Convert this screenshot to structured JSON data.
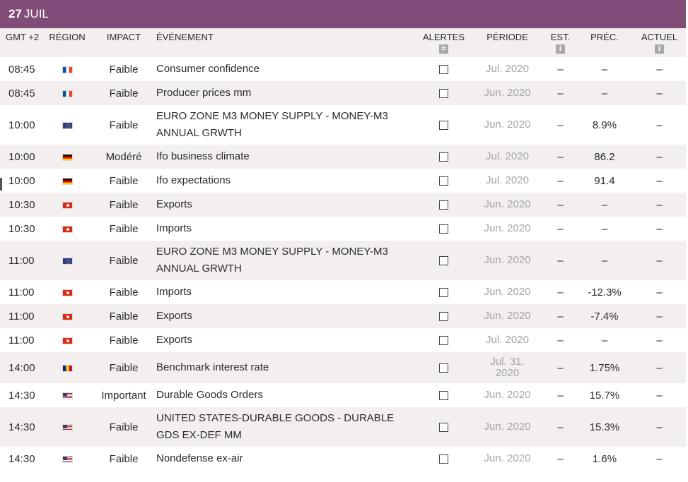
{
  "date": {
    "day": "27",
    "month": "JUIL"
  },
  "columns": {
    "time": "GMT +2",
    "region": "RÉGION",
    "impact": "IMPACT",
    "event": "ÉVÉNEMENT",
    "alerts": "ALERTES",
    "alerts_icon": "gear-icon",
    "period": "PÉRIODE",
    "est": "EST.",
    "est_icon": "info-icon",
    "prev": "PRÉC.",
    "actual": "ACTUEL",
    "actual_icon": "info-icon",
    "info_glyph": "i",
    "gear_glyph": "✲"
  },
  "rows": [
    {
      "time": "08:45",
      "flag": "fr",
      "impact": "Faible",
      "event": "Consumer confidence",
      "period": "Jul. 2020",
      "est": "–",
      "prev": "–",
      "actual": "–"
    },
    {
      "time": "08:45",
      "flag": "fr",
      "impact": "Faible",
      "event": "Producer prices mm",
      "period": "Jun. 2020",
      "est": "–",
      "prev": "–",
      "actual": "–"
    },
    {
      "time": "10:00",
      "flag": "eu",
      "impact": "Faible",
      "event": "EURO ZONE M3 MONEY SUPPLY - MONEY-M3 ANNUAL GRWTH",
      "period": "Jun. 2020",
      "est": "–",
      "prev": "8.9%",
      "actual": "–"
    },
    {
      "time": "10:00",
      "flag": "de",
      "impact": "Modéré",
      "event": "Ifo business climate",
      "period": "Jul. 2020",
      "est": "–",
      "prev": "86.2",
      "actual": "–"
    },
    {
      "time": "10:00",
      "flag": "de",
      "impact": "Faible",
      "event": "Ifo expectations",
      "period": "Jul. 2020",
      "est": "–",
      "prev": "91.4",
      "actual": "–"
    },
    {
      "time": "10:30",
      "flag": "hk",
      "impact": "Faible",
      "event": "Exports",
      "period": "Jun. 2020",
      "est": "–",
      "prev": "–",
      "actual": "–"
    },
    {
      "time": "10:30",
      "flag": "hk",
      "impact": "Faible",
      "event": "Imports",
      "period": "Jun. 2020",
      "est": "–",
      "prev": "–",
      "actual": "–"
    },
    {
      "time": "11:00",
      "flag": "eu",
      "impact": "Faible",
      "event": "EURO ZONE M3 MONEY SUPPLY - MONEY-M3 ANNUAL GRWTH",
      "period": "Jun. 2020",
      "est": "–",
      "prev": "–",
      "actual": "–"
    },
    {
      "time": "11:00",
      "flag": "hk",
      "impact": "Faible",
      "event": "Imports",
      "period": "Jun. 2020",
      "est": "–",
      "prev": "-12.3%",
      "actual": "–"
    },
    {
      "time": "11:00",
      "flag": "hk",
      "impact": "Faible",
      "event": "Exports",
      "period": "Jun. 2020",
      "est": "–",
      "prev": "-7.4%",
      "actual": "–"
    },
    {
      "time": "11:00",
      "flag": "hk",
      "impact": "Faible",
      "event": "Exports",
      "period": "Jul. 2020",
      "est": "–",
      "prev": "–",
      "actual": "–"
    },
    {
      "time": "14:00",
      "flag": "ro",
      "impact": "Faible",
      "event": "Benchmark interest rate",
      "period": "Jul. 31, 2020",
      "est": "–",
      "prev": "1.75%",
      "actual": "–"
    },
    {
      "time": "14:30",
      "flag": "us",
      "impact": "Important",
      "event": "Durable Goods Orders",
      "period": "Jun. 2020",
      "est": "–",
      "prev": "15.7%",
      "actual": "–"
    },
    {
      "time": "14:30",
      "flag": "us",
      "impact": "Faible",
      "event": "UNITED STATES-DURABLE GOODS - DURABLE GDS EX-DEF MM",
      "period": "Jun. 2020",
      "est": "–",
      "prev": "15.3%",
      "actual": "–"
    },
    {
      "time": "14:30",
      "flag": "us",
      "impact": "Faible",
      "event": "Nondefense ex-air",
      "period": "Jun. 2020",
      "est": "–",
      "prev": "1.6%",
      "actual": "–"
    }
  ]
}
